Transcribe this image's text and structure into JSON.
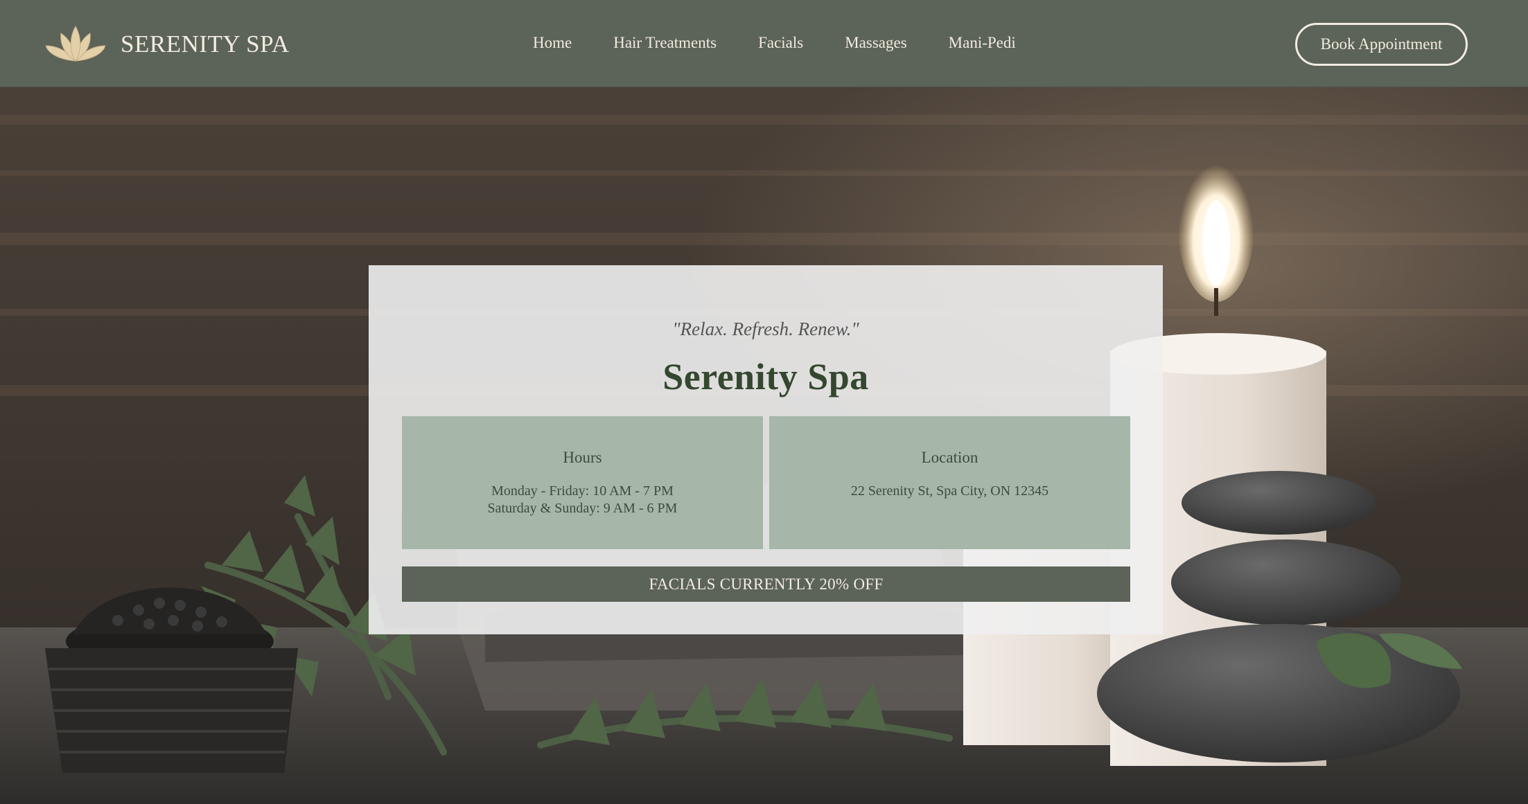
{
  "header": {
    "logo_icon": "lotus-icon",
    "brand": "SERENITY SPA",
    "nav": [
      "Home",
      "Hair Treatments",
      "Facials",
      "Massages",
      "Mani-Pedi"
    ],
    "cta": "Book Appointment"
  },
  "hero": {
    "tagline": "\"Relax. Refresh. Renew.\"",
    "title": "Serenity Spa",
    "hours": {
      "heading": "Hours",
      "lines": [
        "Monday - Friday: 10 AM - 7 PM",
        "Saturday & Sunday: 9 AM - 6 PM"
      ]
    },
    "location": {
      "heading": "Location",
      "address": "22 Serenity St, Spa City, ON 12345"
    },
    "promo": "FACIALS CURRENTLY 20% OFF"
  },
  "colors": {
    "nav_bg": "#5c6358",
    "brand_text": "#f3ece0",
    "title": "#34472f",
    "info_box": "#a6b6a8",
    "lotus": "#e3cfa8"
  }
}
